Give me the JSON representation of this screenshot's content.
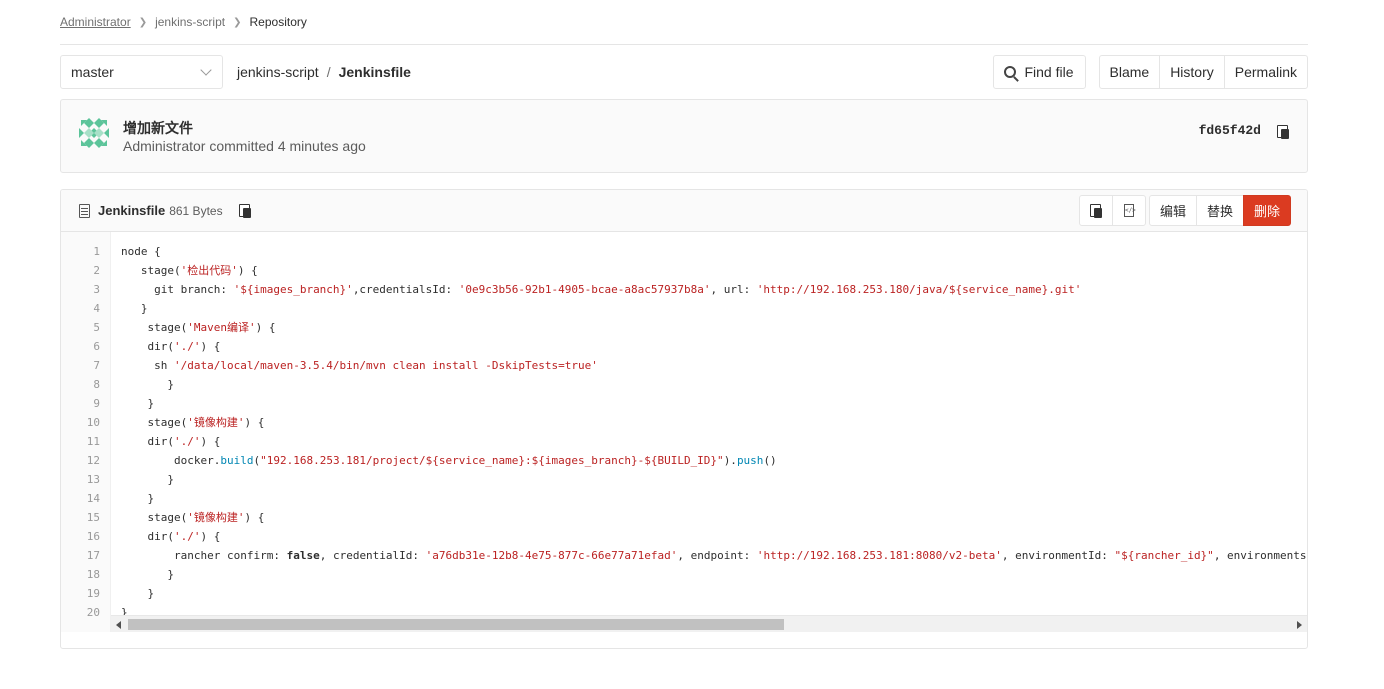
{
  "breadcrumb": {
    "items": [
      "Administrator",
      "jenkins-script",
      "Repository"
    ]
  },
  "nav": {
    "branch": "master",
    "path_repo": "jenkins-script",
    "path_sep": "/",
    "path_file": "Jenkinsfile",
    "find_file": "Find file",
    "blame": "Blame",
    "history": "History",
    "permalink": "Permalink"
  },
  "commit": {
    "title": "增加新文件",
    "meta": "Administrator committed 4 minutes ago",
    "sha": "fd65f42d"
  },
  "file": {
    "name": "Jenkinsfile",
    "size": "861 Bytes",
    "edit": "编辑",
    "replace": "替换",
    "delete": "删除"
  },
  "code": {
    "line_numbers": [
      "1",
      "2",
      "3",
      "4",
      "5",
      "6",
      "7",
      "8",
      "9",
      "10",
      "11",
      "12",
      "13",
      "14",
      "15",
      "16",
      "17",
      "18",
      "19",
      "20"
    ],
    "lines": [
      "node {",
      "   stage('检出代码') {",
      "     git branch: '${images_branch}',credentialsId: '0e9c3b56-92b1-4905-bcae-a8ac57937b8a', url: 'http://192.168.253.180/java/${service_name}.git'",
      "   }",
      "    stage('Maven编译') {",
      "    dir('./') {",
      "     sh '/data/local/maven-3.5.4/bin/mvn clean install -DskipTests=true'",
      "       }",
      "    }",
      "    stage('镜像构建') {",
      "    dir('./') {",
      "        docker.build(\"192.168.253.181/project/${service_name}:${images_branch}-${BUILD_ID}\").push()",
      "       }",
      "    }",
      "    stage('镜像构建') {",
      "    dir('./') {",
      "        rancher confirm: false, credentialId: 'a76db31e-12b8-4e75-877c-66e77a71efad', endpoint: 'http://192.168.253.181:8080/v2-beta', environmentId: \"${rancher_id}\", environments:",
      "       }",
      "    }",
      "}"
    ]
  },
  "colors": {
    "danger": "#db3b21",
    "string": "#bb2222",
    "builtin": "#0086b3"
  }
}
